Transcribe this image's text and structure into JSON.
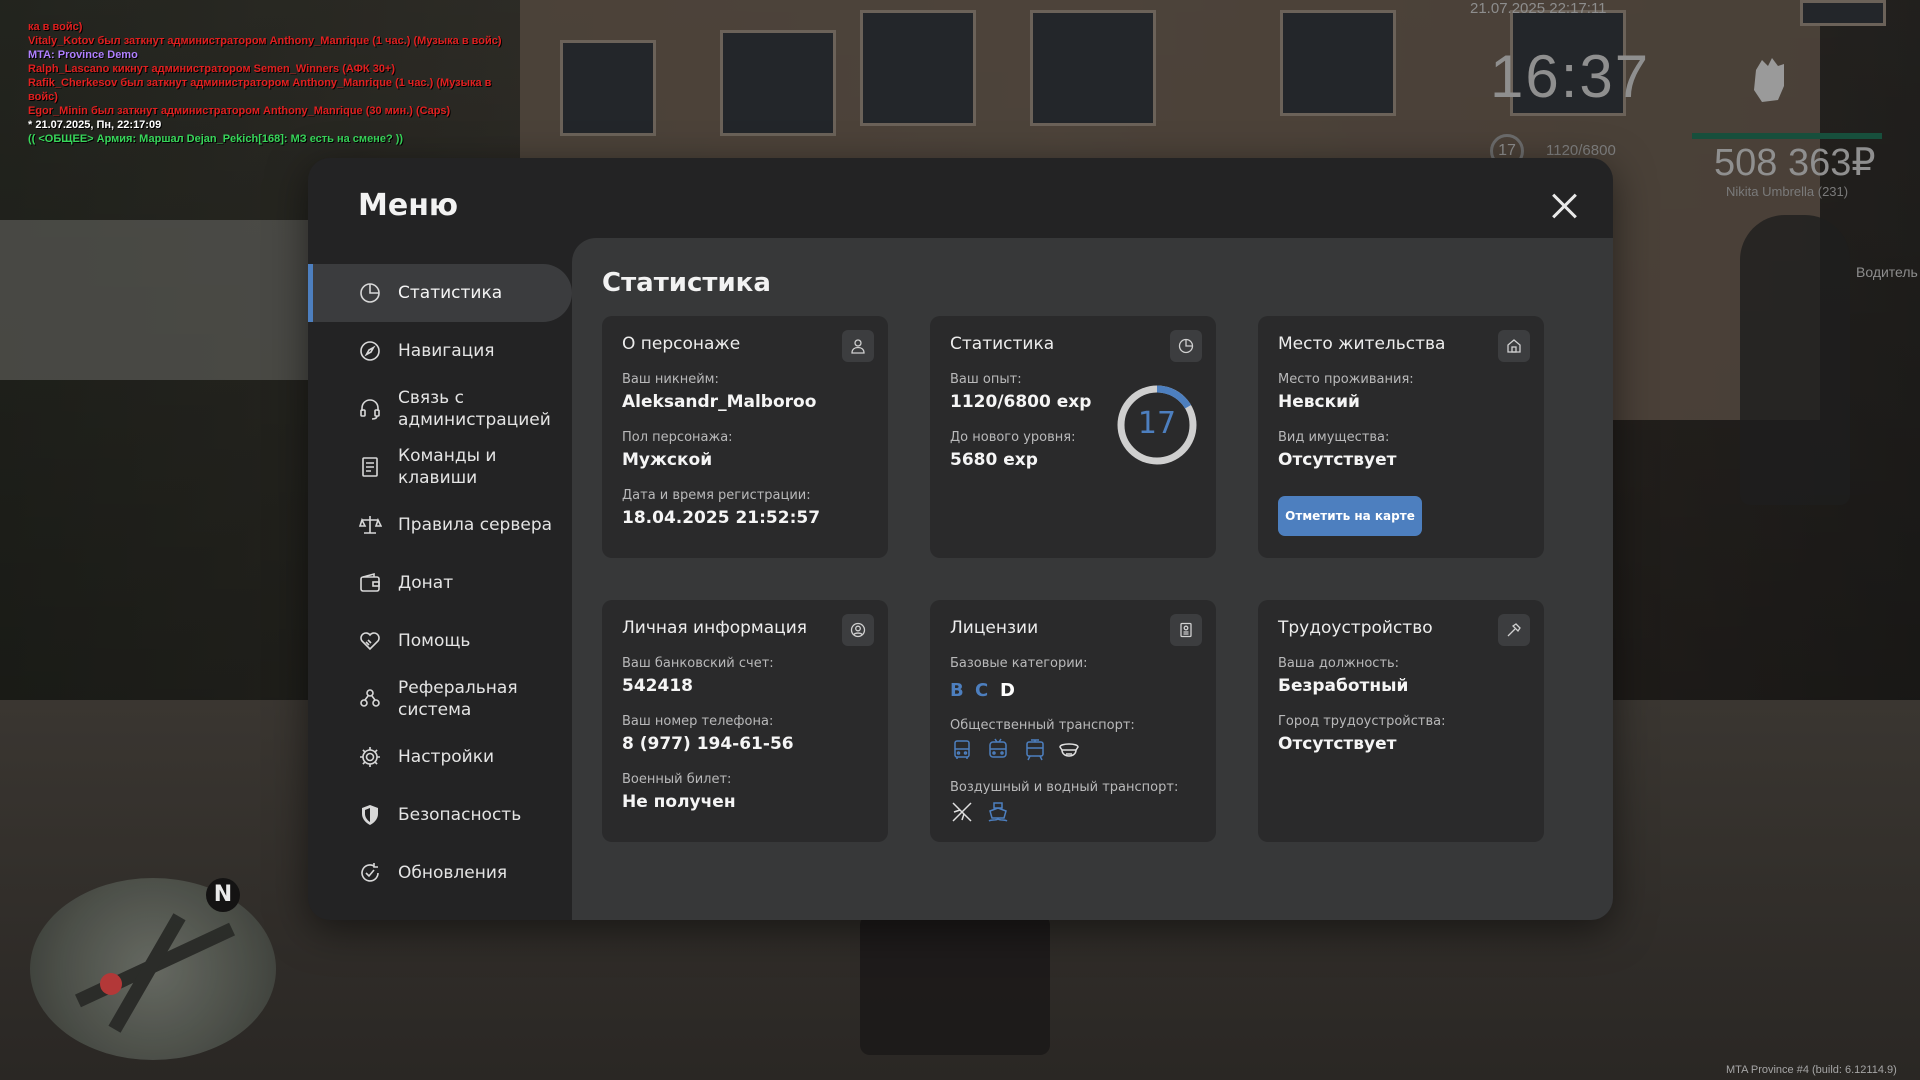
{
  "chat": [
    {
      "text": "ка в войс)",
      "color": "red"
    },
    {
      "text": "Vitaly_Kotov был заткнут администратором Anthony_Manrique (1 час.) (Музыка в войс)",
      "color": "red"
    },
    {
      "text": "MTA: Province Demo",
      "color": "purple"
    },
    {
      "text": "Ralph_Lascano кикнут администратором Semen_Winners (АФК 30+)",
      "color": "red"
    },
    {
      "text": "Rafik_Cherkesov был заткнут администратором Anthony_Manrique (1 час.) (Музыка в войс)",
      "color": "red"
    },
    {
      "text": "Egor_Minin был заткнут администратором Anthony_Manrique (30 мин.) (Caps)",
      "color": "red"
    },
    {
      "text": "* 21.07.2025, Пн, 22:17:09",
      "color": "white"
    },
    {
      "text": "(( <ОБЩЕЕ> Армия: Маршал Dejan_Pekich[168]: МЗ есть на смене? ))",
      "color": "green"
    }
  ],
  "hud": {
    "date": "21.07.2025 22:17:11",
    "time": "16:37",
    "level": "17",
    "exp": "1120/6800",
    "money": "508 363₽",
    "player_name": "Nikita Umbrella (231)",
    "driver_label": "Водитель",
    "build": "MTA Province #4 (build: 6.12114.9)",
    "minimap_north": "N"
  },
  "menu": {
    "title": "Меню",
    "content_title": "Статистика",
    "nav": [
      {
        "label": "Статистика",
        "icon": "pie-chart-icon",
        "active": true
      },
      {
        "label": "Навигация",
        "icon": "compass-icon"
      },
      {
        "label": "Связь с администрацией",
        "icon": "headset-icon"
      },
      {
        "label": "Команды и клавиши",
        "icon": "document-list-icon"
      },
      {
        "label": "Правила сервера",
        "icon": "scales-icon"
      },
      {
        "label": "Донат",
        "icon": "wallet-icon"
      },
      {
        "label": "Помощь",
        "icon": "handshake-heart-icon"
      },
      {
        "label": "Реферальная система",
        "icon": "people-icon"
      },
      {
        "label": "Настройки",
        "icon": "gear-icon"
      },
      {
        "label": "Безопасность",
        "icon": "shield-icon"
      },
      {
        "label": "Обновления",
        "icon": "refresh-check-icon"
      }
    ]
  },
  "cards": {
    "character": {
      "title": "О персонаже",
      "icon": "user-icon",
      "nickname_label": "Ваш никнейм:",
      "nickname": "Aleksandr_Malboroo",
      "gender_label": "Пол персонажа:",
      "gender": "Мужской",
      "reg_label": "Дата и время регистрации:",
      "reg": "18.04.2025 21:52:57"
    },
    "stats": {
      "title": "Статистика",
      "icon": "pie-chart-icon",
      "exp_label": "Ваш опыт:",
      "exp": "1120/6800 exp",
      "next_label": "До нового уровня:",
      "next": "5680 exp",
      "level": "17",
      "progress": 0.165
    },
    "residence": {
      "title": "Место жительства",
      "icon": "house-icon",
      "place_label": "Место проживания:",
      "place": "Невский",
      "property_label": "Вид имущества:",
      "property": "Отсутствует",
      "button": "Отметить на карте"
    },
    "personal": {
      "title": "Личная информация",
      "icon": "user-circle-icon",
      "bank_label": "Ваш банковский счет:",
      "bank": "542418",
      "phone_label": "Ваш номер телефона:",
      "phone": "8 (977) 194-61-56",
      "military_label": "Военный билет:",
      "military": "Не получен"
    },
    "licenses": {
      "title": "Лицензии",
      "icon": "id-card-icon",
      "base_label": "Базовые категории:",
      "categories": [
        {
          "letter": "B",
          "color": "#4d7fbf"
        },
        {
          "letter": "C",
          "color": "#4d7fbf"
        },
        {
          "letter": "D",
          "color": "#ffffff"
        }
      ],
      "public_label": "Общественный транспорт:",
      "public_icons": [
        {
          "name": "bus-icon",
          "active": true
        },
        {
          "name": "trolleybus-icon",
          "active": true
        },
        {
          "name": "tram-icon",
          "active": true
        },
        {
          "name": "driver-cap-icon",
          "active": false
        }
      ],
      "air_label": "Воздушный и водный транспорт:",
      "air_icons": [
        {
          "name": "airplane-icon",
          "active": false
        },
        {
          "name": "boat-icon",
          "active": true
        }
      ]
    },
    "employment": {
      "title": "Трудоустройство",
      "icon": "hammer-icon",
      "position_label": "Ваша должность:",
      "position": "Безработный",
      "city_label": "Город трудоустройства:",
      "city": "Отсутствует"
    }
  },
  "colors": {
    "accent": "#4d7fbf",
    "panel": "#232324",
    "content": "#373839",
    "card": "#2a2a2b"
  }
}
